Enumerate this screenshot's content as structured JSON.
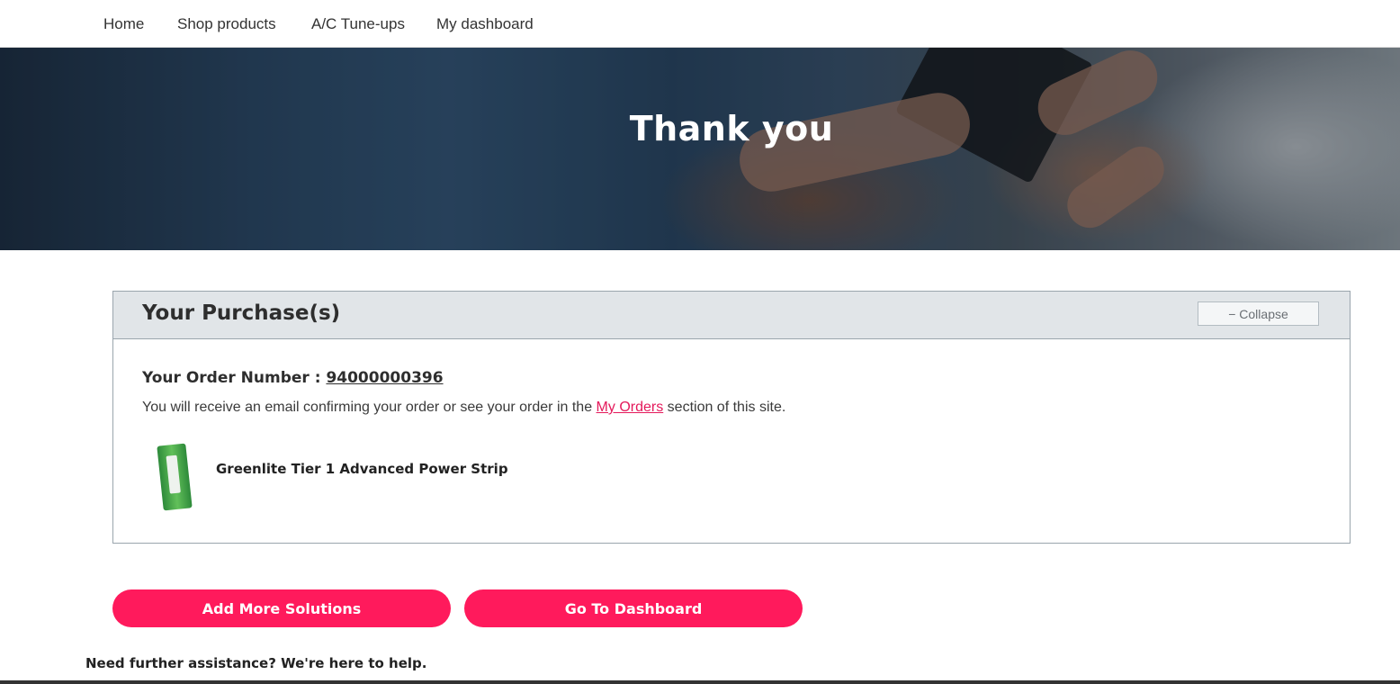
{
  "nav": {
    "items": [
      {
        "label": "Home"
      },
      {
        "label": "Shop products"
      },
      {
        "label": "A/C Tune-ups"
      },
      {
        "label": "My dashboard"
      }
    ]
  },
  "hero": {
    "title": "Thank you"
  },
  "purchase_panel": {
    "title": "Your Purchase(s)",
    "collapse_label": "− Collapse",
    "order_label": "Your Order Number : ",
    "order_number": "94000000396",
    "confirm_prefix": "You will receive an email confirming your order or see your order in the ",
    "my_orders_link": "My Orders",
    "confirm_suffix": " section of this site.",
    "items": [
      {
        "name": "Greenlite Tier 1 Advanced Power Strip"
      }
    ]
  },
  "actions": {
    "add_more": "Add More Solutions",
    "go_dashboard": "Go To Dashboard"
  },
  "help_text": "Need further assistance? We're here to help.",
  "colors": {
    "accent": "#ff1a5c",
    "link": "#e4195b",
    "panel_header_bg": "#e1e5e8"
  }
}
